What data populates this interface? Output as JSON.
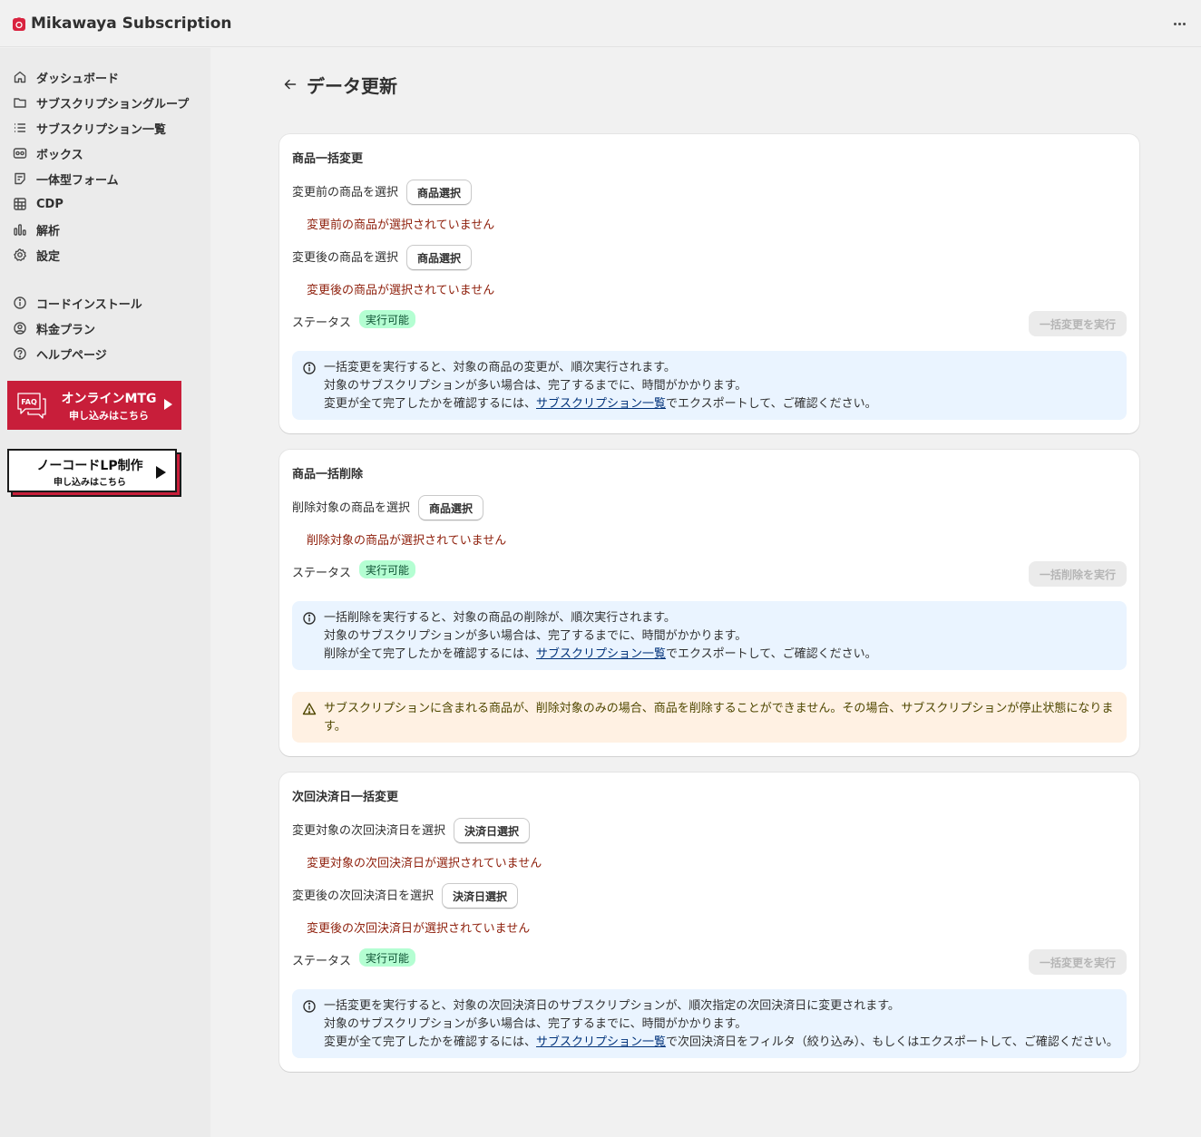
{
  "app": {
    "title": "Mikawaya Subscription"
  },
  "sidebar": {
    "items": [
      {
        "label": "ダッシュボード",
        "icon": "home-icon"
      },
      {
        "label": "サブスクリプショングループ",
        "icon": "folder-icon"
      },
      {
        "label": "サブスクリプション一覧",
        "icon": "list-icon"
      },
      {
        "label": "ボックス",
        "icon": "box-icon"
      },
      {
        "label": "一体型フォーム",
        "icon": "form-icon"
      },
      {
        "label": "CDP",
        "icon": "grid-icon"
      },
      {
        "label": "解析",
        "icon": "bar-chart-icon"
      },
      {
        "label": "設定",
        "icon": "gear-icon"
      }
    ],
    "secondary": [
      {
        "label": "コードインストール",
        "icon": "info-icon"
      },
      {
        "label": "料金プラン",
        "icon": "person-icon"
      },
      {
        "label": "ヘルプページ",
        "icon": "help-icon"
      }
    ],
    "banner_mtg": {
      "badge": "FAQ",
      "title": "オンラインMTG",
      "sub": "申し込みはこちら"
    },
    "banner_lp": {
      "title": "ノーコードLP制作",
      "sub": "申し込みはこちら"
    }
  },
  "page": {
    "title": "データ更新"
  },
  "sections": {
    "bulk_change": {
      "title": "商品一括変更",
      "before_label": "変更前の商品を選択",
      "before_button": "商品選択",
      "before_error": "変更前の商品が選択されていません",
      "after_label": "変更後の商品を選択",
      "after_button": "商品選択",
      "after_error": "変更後の商品が選択されていません",
      "status_label": "ステータス",
      "status_badge": "実行可能",
      "execute_button": "一括変更を実行",
      "info_line1": "一括変更を実行すると、対象の商品の変更が、順次実行されます。",
      "info_line2": "対象のサブスクリプションが多い場合は、完了するまでに、時間がかかります。",
      "info_line3_pre": "変更が全て完了したかを確認するには、",
      "info_link": "サブスクリプション一覧",
      "info_line3_post": "でエクスポートして、ご確認ください。"
    },
    "bulk_delete": {
      "title": "商品一括削除",
      "target_label": "削除対象の商品を選択",
      "target_button": "商品選択",
      "target_error": "削除対象の商品が選択されていません",
      "status_label": "ステータス",
      "status_badge": "実行可能",
      "execute_button": "一括削除を実行",
      "info_line1": "一括削除を実行すると、対象の商品の削除が、順次実行されます。",
      "info_line2": "対象のサブスクリプションが多い場合は、完了するまでに、時間がかかります。",
      "info_line3_pre": "削除が全て完了したかを確認するには、",
      "info_link": "サブスクリプション一覧",
      "info_line3_post": "でエクスポートして、ご確認ください。",
      "warning_line1": "サブスクリプションに含まれる商品が、削除対象のみの場合、商品を削除することができません。その場合、サブスクリプションが停止状態になりま",
      "warning_line2": "す。"
    },
    "next_billing": {
      "title": "次回決済日一括変更",
      "target_label": "変更対象の次回決済日を選択",
      "target_button": "決済日選択",
      "target_error": "変更対象の次回決済日が選択されていません",
      "after_label": "変更後の次回決済日を選択",
      "after_button": "決済日選択",
      "after_error": "変更後の次回決済日が選択されていません",
      "status_label": "ステータス",
      "status_badge": "実行可能",
      "execute_button": "一括変更を実行",
      "info_line1": "一括変更を実行すると、対象の次回決済日のサブスクリプションが、順次指定の次回決済日に変更されます。",
      "info_line2": "対象のサブスクリプションが多い場合は、完了するまでに、時間がかかります。",
      "info_line3_pre": "変更が全て完了したかを確認するには、",
      "info_link": "サブスクリプション一覧",
      "info_line3_post": "で次回決済日をフィルタ（絞り込み）、もしくはエクスポートして、ご確認ください。"
    }
  },
  "colors": {
    "brand_red": "#c81e3a",
    "error_text": "#8e1f0b",
    "success_badge": "#b4fed2",
    "info_bg": "#eaf4ff",
    "warning_bg": "#fff1e3"
  }
}
